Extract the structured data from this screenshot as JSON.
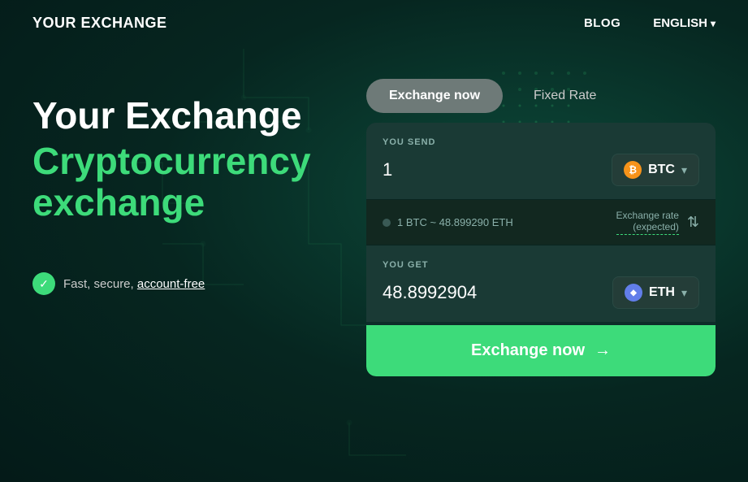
{
  "brand": {
    "logo": "YOUR EXCHANGE"
  },
  "navbar": {
    "blog_label": "BLOG",
    "lang_label": "ENGLISH",
    "lang_chevron": "▾"
  },
  "hero": {
    "line1": "Your Exchange",
    "line2": "Cryptocurrency",
    "line3": "exchange",
    "badge_text": "Fast, secure, ",
    "badge_link": "account-free"
  },
  "tabs": {
    "active_label": "Exchange now",
    "inactive_label": "Fixed Rate"
  },
  "widget": {
    "send_label": "YOU SEND",
    "send_amount": "1",
    "send_currency": "BTC",
    "rate_text": "1 BTC ~ 48.899290 ETH",
    "rate_expected_label": "Exchange rate",
    "rate_expected_sub": "(expected)",
    "get_label": "YOU GET",
    "get_amount": "48.8992904",
    "get_currency": "ETH",
    "exchange_btn_label": "Exchange now"
  }
}
